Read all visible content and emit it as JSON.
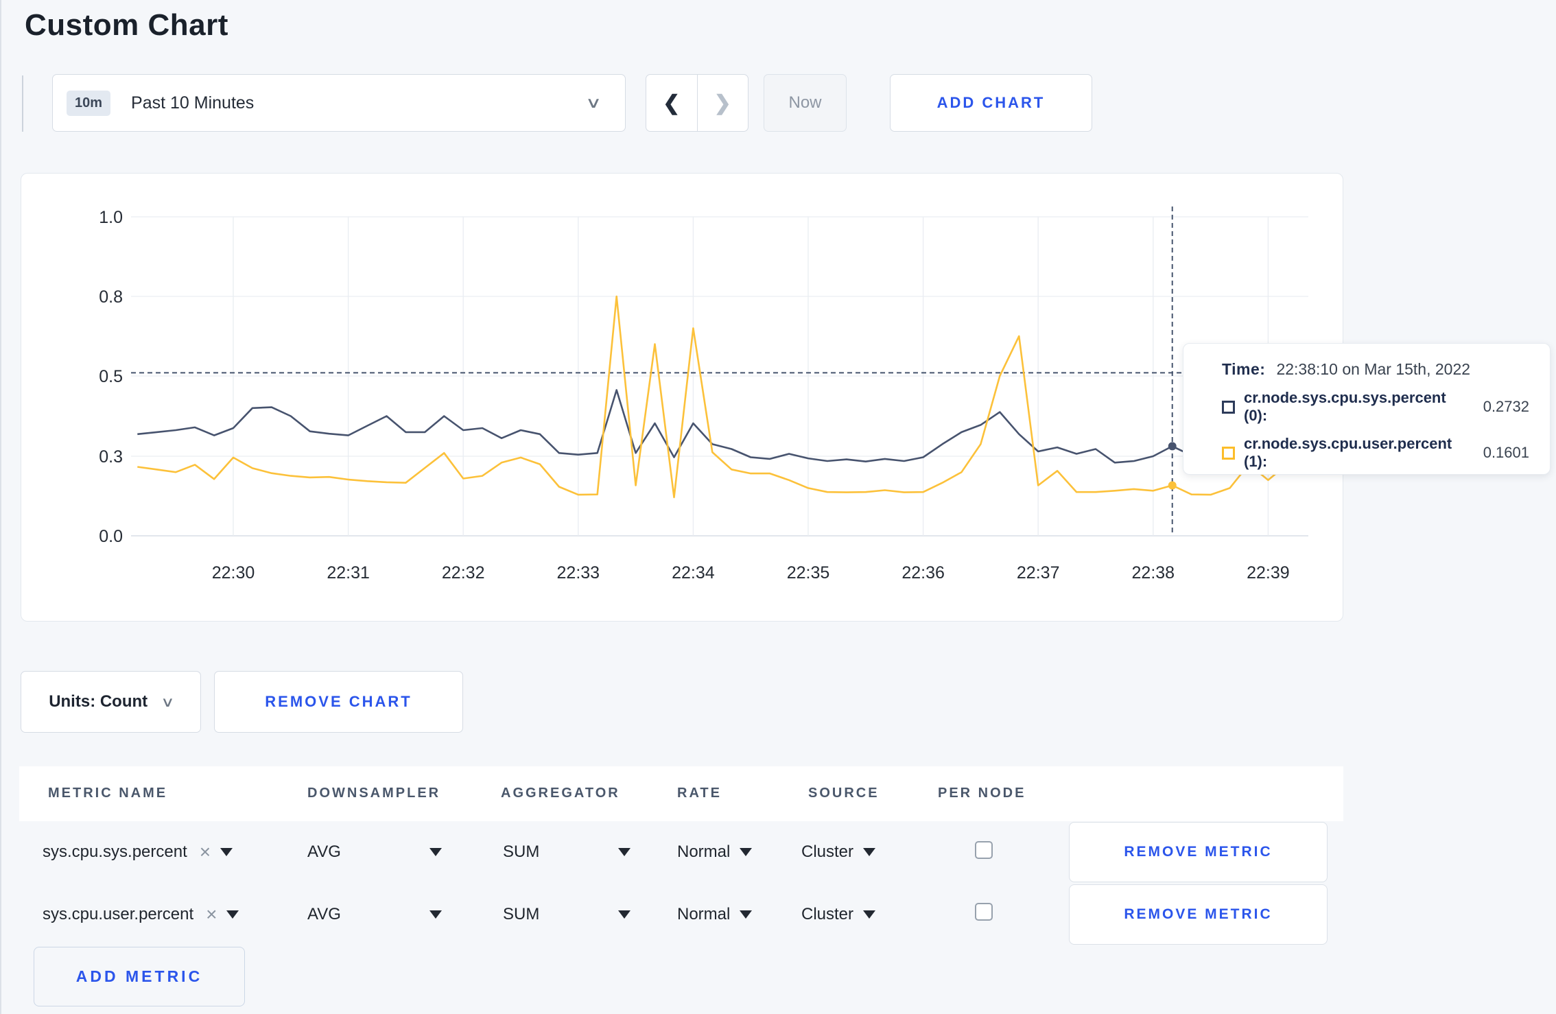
{
  "page": {
    "title": "Custom Chart"
  },
  "toolbar": {
    "time_badge": "10m",
    "time_label": "Past 10 Minutes",
    "prev_icon": "❮",
    "next_icon": "❯",
    "chevron": "∨",
    "now_label": "Now",
    "add_chart_label": "ADD CHART"
  },
  "colors": {
    "accent_blue": "#2b55eb",
    "series_sys": "#47536e",
    "series_user": "#fcc13a",
    "crosshair": "#46546d",
    "grid": "#e9edf2"
  },
  "chart_data": {
    "type": "line",
    "title": "",
    "xlabel": "",
    "ylabel": "",
    "ylim": [
      0.0,
      1.0
    ],
    "grid": true,
    "legend_position": "tooltip",
    "x_ticks": [
      "22:30",
      "22:31",
      "22:32",
      "22:33",
      "22:34",
      "22:35",
      "22:36",
      "22:37",
      "22:38",
      "22:39"
    ],
    "y_ticks": [
      0.0,
      0.3,
      0.5,
      0.8,
      1.0
    ],
    "y_tick_labels": [
      "0.0",
      "0.3",
      "0.5",
      "0.8",
      "1.0"
    ],
    "crosshair": {
      "time": "22:38:10",
      "hline_value": 0.512,
      "dot_values": [
        0.325,
        0.19
      ]
    },
    "series": [
      {
        "name": "cr.node.sys.cpu.sys.percent",
        "color": "#47536e",
        "values": [
          [
            "22:29:10",
            0.355
          ],
          [
            "22:29:20",
            0.36
          ],
          [
            "22:29:30",
            0.365
          ],
          [
            "22:29:40",
            0.372
          ],
          [
            "22:29:50",
            0.352
          ],
          [
            "22:30:00",
            0.37
          ],
          [
            "22:30:10",
            0.42
          ],
          [
            "22:30:20",
            0.422
          ],
          [
            "22:30:30",
            0.4
          ],
          [
            "22:30:40",
            0.362
          ],
          [
            "22:30:50",
            0.356
          ],
          [
            "22:31:00",
            0.352
          ],
          [
            "22:31:10",
            0.376
          ],
          [
            "22:31:20",
            0.4
          ],
          [
            "22:31:30",
            0.36
          ],
          [
            "22:31:40",
            0.36
          ],
          [
            "22:31:50",
            0.4
          ],
          [
            "22:32:00",
            0.365
          ],
          [
            "22:32:10",
            0.37
          ],
          [
            "22:32:20",
            0.345
          ],
          [
            "22:32:30",
            0.365
          ],
          [
            "22:32:40",
            0.355
          ],
          [
            "22:32:50",
            0.308
          ],
          [
            "22:33:00",
            0.304
          ],
          [
            "22:33:10",
            0.308
          ],
          [
            "22:33:20",
            0.465
          ],
          [
            "22:33:30",
            0.308
          ],
          [
            "22:33:40",
            0.382
          ],
          [
            "22:33:50",
            0.296
          ],
          [
            "22:34:00",
            0.382
          ],
          [
            "22:34:10",
            0.33
          ],
          [
            "22:34:20",
            0.318
          ],
          [
            "22:34:30",
            0.296
          ],
          [
            "22:34:40",
            0.29
          ],
          [
            "22:34:50",
            0.306
          ],
          [
            "22:35:00",
            0.292
          ],
          [
            "22:35:10",
            0.282
          ],
          [
            "22:35:20",
            0.288
          ],
          [
            "22:35:30",
            0.28
          ],
          [
            "22:35:40",
            0.29
          ],
          [
            "22:35:50",
            0.282
          ],
          [
            "22:36:00",
            0.296
          ],
          [
            "22:36:10",
            0.33
          ],
          [
            "22:36:20",
            0.36
          ],
          [
            "22:36:30",
            0.378
          ],
          [
            "22:36:40",
            0.41
          ],
          [
            "22:36:50",
            0.355
          ],
          [
            "22:37:00",
            0.312
          ],
          [
            "22:37:10",
            0.322
          ],
          [
            "22:37:20",
            0.306
          ],
          [
            "22:37:30",
            0.318
          ],
          [
            "22:37:40",
            0.276
          ],
          [
            "22:37:50",
            0.282
          ],
          [
            "22:38:00",
            0.3
          ],
          [
            "22:38:10",
            0.325
          ],
          [
            "22:38:20",
            0.302
          ],
          [
            "22:38:30",
            0.3
          ],
          [
            "22:38:40",
            0.308
          ],
          [
            "22:38:50",
            0.312
          ],
          [
            "22:39:00",
            0.3
          ],
          [
            "22:39:10",
            0.304
          ],
          [
            "22:39:20",
            0.298
          ]
        ]
      },
      {
        "name": "cr.node.sys.cpu.user.percent",
        "color": "#fcc13a",
        "values": [
          [
            "22:29:10",
            0.26
          ],
          [
            "22:29:20",
            0.25
          ],
          [
            "22:29:30",
            0.24
          ],
          [
            "22:29:40",
            0.268
          ],
          [
            "22:29:50",
            0.214
          ],
          [
            "22:30:00",
            0.295
          ],
          [
            "22:30:10",
            0.255
          ],
          [
            "22:30:20",
            0.236
          ],
          [
            "22:30:30",
            0.226
          ],
          [
            "22:30:40",
            0.22
          ],
          [
            "22:30:50",
            0.222
          ],
          [
            "22:31:00",
            0.212
          ],
          [
            "22:31:10",
            0.206
          ],
          [
            "22:31:20",
            0.202
          ],
          [
            "22:31:30",
            0.2
          ],
          [
            "22:31:40",
            0.256
          ],
          [
            "22:31:50",
            0.308
          ],
          [
            "22:32:00",
            0.216
          ],
          [
            "22:32:10",
            0.226
          ],
          [
            "22:32:20",
            0.276
          ],
          [
            "22:32:30",
            0.295
          ],
          [
            "22:32:40",
            0.27
          ],
          [
            "22:32:50",
            0.185
          ],
          [
            "22:33:00",
            0.155
          ],
          [
            "22:33:10",
            0.156
          ],
          [
            "22:33:20",
            0.8
          ],
          [
            "22:33:30",
            0.19
          ],
          [
            "22:33:40",
            0.62
          ],
          [
            "22:33:50",
            0.145
          ],
          [
            "22:34:00",
            0.68
          ],
          [
            "22:34:10",
            0.31
          ],
          [
            "22:34:20",
            0.25
          ],
          [
            "22:34:30",
            0.235
          ],
          [
            "22:34:40",
            0.235
          ],
          [
            "22:34:50",
            0.21
          ],
          [
            "22:35:00",
            0.18
          ],
          [
            "22:35:10",
            0.165
          ],
          [
            "22:35:20",
            0.164
          ],
          [
            "22:35:30",
            0.165
          ],
          [
            "22:35:40",
            0.172
          ],
          [
            "22:35:50",
            0.164
          ],
          [
            "22:36:00",
            0.165
          ],
          [
            "22:36:10",
            0.2
          ],
          [
            "22:36:20",
            0.24
          ],
          [
            "22:36:30",
            0.33
          ],
          [
            "22:36:40",
            0.5
          ],
          [
            "22:36:50",
            0.65
          ],
          [
            "22:37:00",
            0.19
          ],
          [
            "22:37:10",
            0.245
          ],
          [
            "22:37:20",
            0.165
          ],
          [
            "22:37:30",
            0.165
          ],
          [
            "22:37:40",
            0.17
          ],
          [
            "22:37:50",
            0.176
          ],
          [
            "22:38:00",
            0.17
          ],
          [
            "22:38:10",
            0.19
          ],
          [
            "22:38:20",
            0.156
          ],
          [
            "22:38:30",
            0.155
          ],
          [
            "22:38:40",
            0.18
          ],
          [
            "22:38:50",
            0.27
          ],
          [
            "22:39:00",
            0.21
          ],
          [
            "22:39:10",
            0.27
          ],
          [
            "22:39:20",
            0.24
          ]
        ]
      }
    ]
  },
  "tooltip": {
    "time_label": "Time:",
    "time_value": "22:38:10 on Mar 15th, 2022",
    "series": [
      {
        "label": "cr.node.sys.cpu.sys.percent (0):",
        "value": "0.2732",
        "color": "#2d3b5a"
      },
      {
        "label": "cr.node.sys.cpu.user.percent (1):",
        "value": "0.1601",
        "color": "#fcbd2a"
      }
    ]
  },
  "chart_actions": {
    "units_label": "Units: Count",
    "units_chevron": "∨",
    "remove_chart_label": "REMOVE CHART"
  },
  "metrics_table": {
    "headers": [
      "METRIC NAME",
      "DOWNSAMPLER",
      "AGGREGATOR",
      "RATE",
      "SOURCE",
      "PER NODE"
    ],
    "remove_metric_label": "REMOVE METRIC",
    "add_metric_label": "ADD METRIC",
    "remove_x": "×",
    "rows": [
      {
        "metric": "sys.cpu.sys.percent",
        "downsampler": "AVG",
        "aggregator": "SUM",
        "rate": "Normal",
        "source": "Cluster",
        "per_node_checked": false
      },
      {
        "metric": "sys.cpu.user.percent",
        "downsampler": "AVG",
        "aggregator": "SUM",
        "rate": "Normal",
        "source": "Cluster",
        "per_node_checked": false
      }
    ]
  }
}
